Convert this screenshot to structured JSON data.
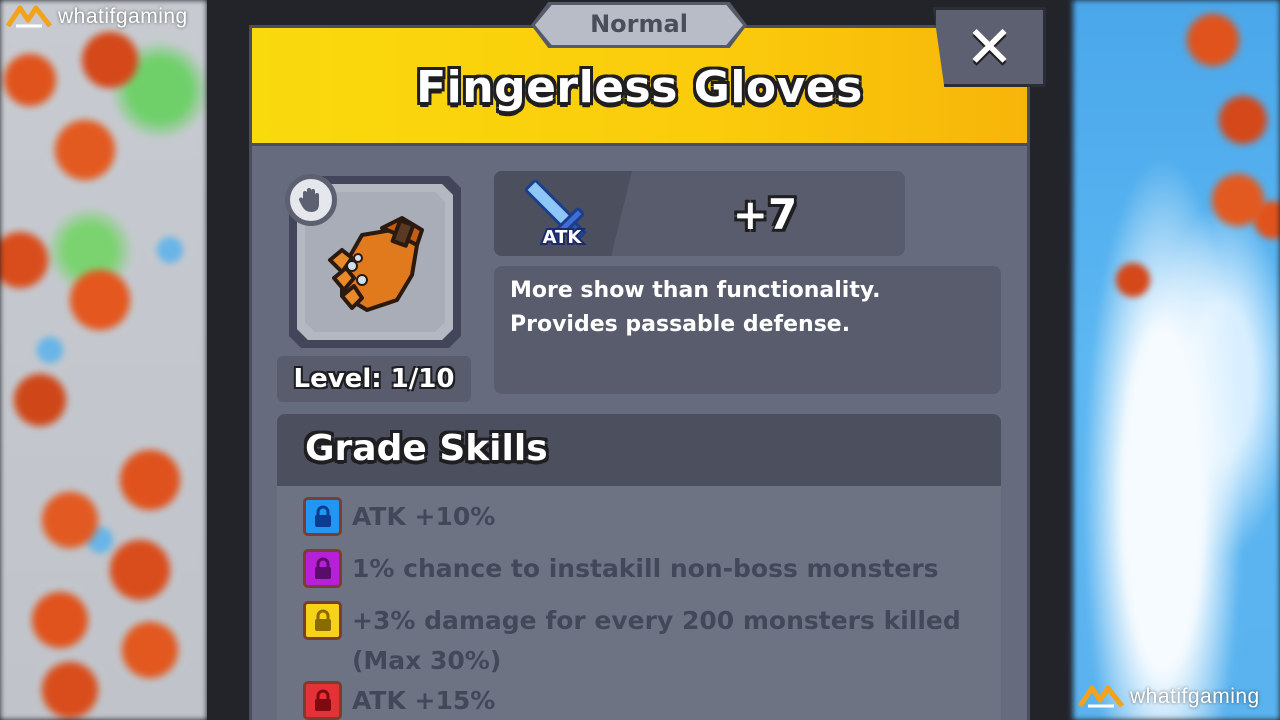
{
  "watermark": {
    "text": "whatifgaming"
  },
  "dialog": {
    "rarity": "Normal",
    "title": "Fingerless Gloves",
    "close_label": "✕",
    "colors": {
      "header_yellow": "#fbcb0c",
      "panel": "#666b7d",
      "dark": "#4b4f5e"
    }
  },
  "item": {
    "slot_icon": "glove-slot-icon",
    "icon": "fingerless-gloves-icon",
    "level": "Level: 1/10"
  },
  "stat": {
    "icon": "sword-atk-icon",
    "icon_label": "ATK",
    "value": "+7"
  },
  "description": "More show than functionality. Provides passable defense.",
  "grade_skills": {
    "title": "Grade Skills",
    "skills": [
      {
        "text": "ATK +10%",
        "lock_color": "#2196f3"
      },
      {
        "text": "1% chance to instakill non-boss monsters",
        "lock_color": "#b620d6"
      },
      {
        "text": "+3% damage for every 200 monsters killed (Max 30%)",
        "lock_color": "#f6d21a"
      },
      {
        "text": "ATK +15%",
        "lock_color": "#e53238"
      }
    ]
  }
}
